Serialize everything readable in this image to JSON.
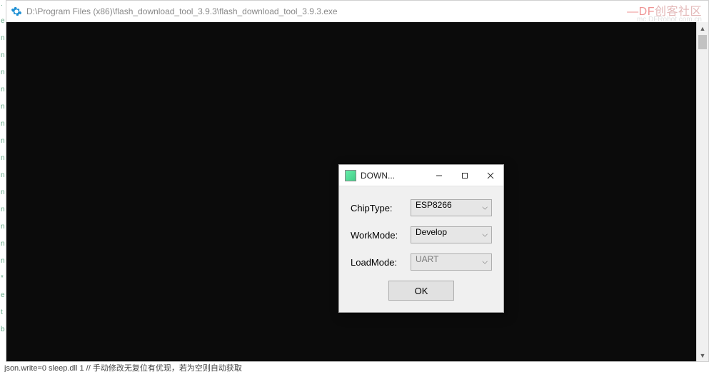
{
  "console": {
    "title": "D:\\Program Files (x86)\\flash_download_tool_3.9.3\\flash_download_tool_3.9.3.exe"
  },
  "watermark": {
    "prefix": "—",
    "brand1": "DF",
    "brand2": "创客社区",
    "sub": "mc.DFRobot.com.cn"
  },
  "dialog": {
    "title": "DOWN...",
    "fields": {
      "chipType": {
        "label": "ChipType:",
        "value": "ESP8266"
      },
      "workMode": {
        "label": "WorkMode:",
        "value": "Develop"
      },
      "loadMode": {
        "label": "LoadMode:",
        "value": "UART",
        "disabled": true
      }
    },
    "ok_label": "OK"
  },
  "bottom_text": "json.write=0 sleep.dll 1 // 手动修改无复位有优现，若为空则自动获取"
}
